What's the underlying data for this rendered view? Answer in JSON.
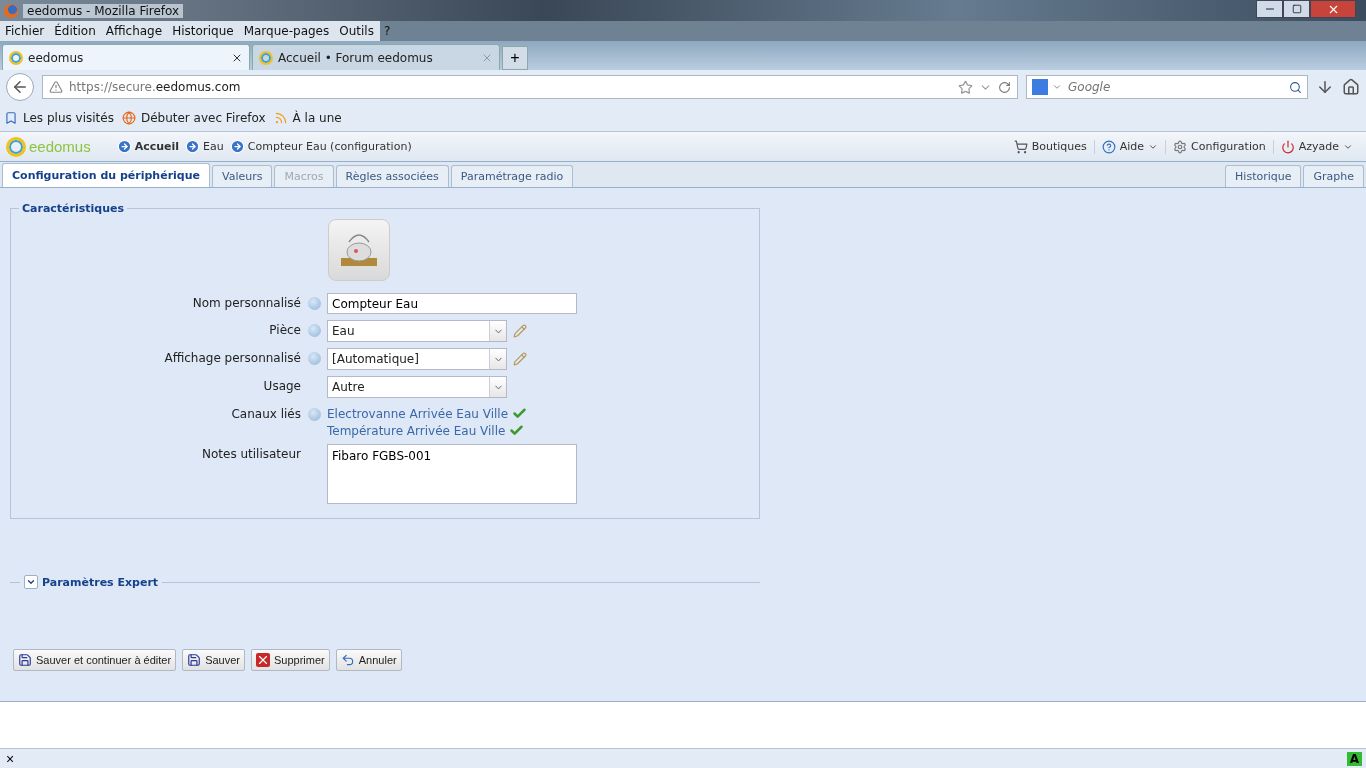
{
  "window": {
    "title": "eedomus - Mozilla Firefox"
  },
  "menu": [
    {
      "label": "Fichier"
    },
    {
      "label": "Édition"
    },
    {
      "label": "Affichage"
    },
    {
      "label": "Historique"
    },
    {
      "label": "Marque-pages"
    },
    {
      "label": "Outils"
    },
    {
      "label": "?"
    }
  ],
  "browser_tabs": [
    {
      "label": "eedomus",
      "selected": true
    },
    {
      "label": "Accueil • Forum eedomus",
      "selected": false
    }
  ],
  "new_tab": "+",
  "address": {
    "prefix": "https://secure.",
    "domain": "eedomus.com"
  },
  "search": {
    "placeholder": "Google"
  },
  "bookmarks": [
    {
      "label": "Les plus visités",
      "kind": "page"
    },
    {
      "label": "Débuter avec Firefox",
      "kind": "globe"
    },
    {
      "label": "À la une",
      "kind": "feed"
    }
  ],
  "app": {
    "logo": "eedomus",
    "breadcrumbs": [
      {
        "label": "Accueil",
        "bold": true
      },
      {
        "label": "Eau",
        "bold": false
      },
      {
        "label": "Compteur Eau (configuration)",
        "bold": false
      }
    ],
    "header_menu": [
      {
        "label": "Boutiques",
        "kind": "cart",
        "dropdown": false
      },
      {
        "label": "Aide",
        "kind": "help",
        "dropdown": true
      },
      {
        "label": "Configuration",
        "kind": "gear",
        "dropdown": false
      },
      {
        "label": "Azyade",
        "kind": "power",
        "dropdown": true
      }
    ]
  },
  "tabs": [
    {
      "label": "Configuration du périphérique",
      "selected": true,
      "disabled": false
    },
    {
      "label": "Valeurs",
      "selected": false,
      "disabled": false
    },
    {
      "label": "Macros",
      "selected": false,
      "disabled": true
    },
    {
      "label": "Règles associées",
      "selected": false,
      "disabled": false
    },
    {
      "label": "Paramétrage radio",
      "selected": false,
      "disabled": false
    }
  ],
  "right_tabs": [
    {
      "label": "Historique",
      "selected": false
    },
    {
      "label": "Graphe",
      "selected": false
    }
  ],
  "section": {
    "title": "Caractéristiques",
    "fields": [
      {
        "kind": "text",
        "label": "Nom personnalisé",
        "help": true,
        "value": "Compteur Eau"
      },
      {
        "kind": "select",
        "label": "Pièce",
        "help": true,
        "value": "Eau",
        "editable": true
      },
      {
        "kind": "select",
        "label": "Affichage personnalisé",
        "help": true,
        "value": "[Automatique]",
        "editable": true
      },
      {
        "kind": "select",
        "label": "Usage",
        "help": false,
        "value": "Autre",
        "editable": false
      },
      {
        "kind": "links",
        "label": "Canaux liés",
        "help": true,
        "links": [
          {
            "label": "Electrovanne Arrivée Eau Ville",
            "checked": true
          },
          {
            "label": "Température Arrivée Eau Ville",
            "checked": true
          }
        ]
      },
      {
        "kind": "textarea",
        "label": "Notes utilisateur",
        "help": false,
        "value": "Fibaro FGBS-001"
      }
    ]
  },
  "expert": {
    "title": "Paramètres Expert",
    "expanded": false
  },
  "buttons": [
    {
      "label": "Sauver et continuer à éditer",
      "kind": "save"
    },
    {
      "label": "Sauver",
      "kind": "save"
    },
    {
      "label": "Supprimer",
      "kind": "delete"
    },
    {
      "label": "Annuler",
      "kind": "undo"
    }
  ],
  "status_bar": {
    "close": "×",
    "addon": "A"
  }
}
